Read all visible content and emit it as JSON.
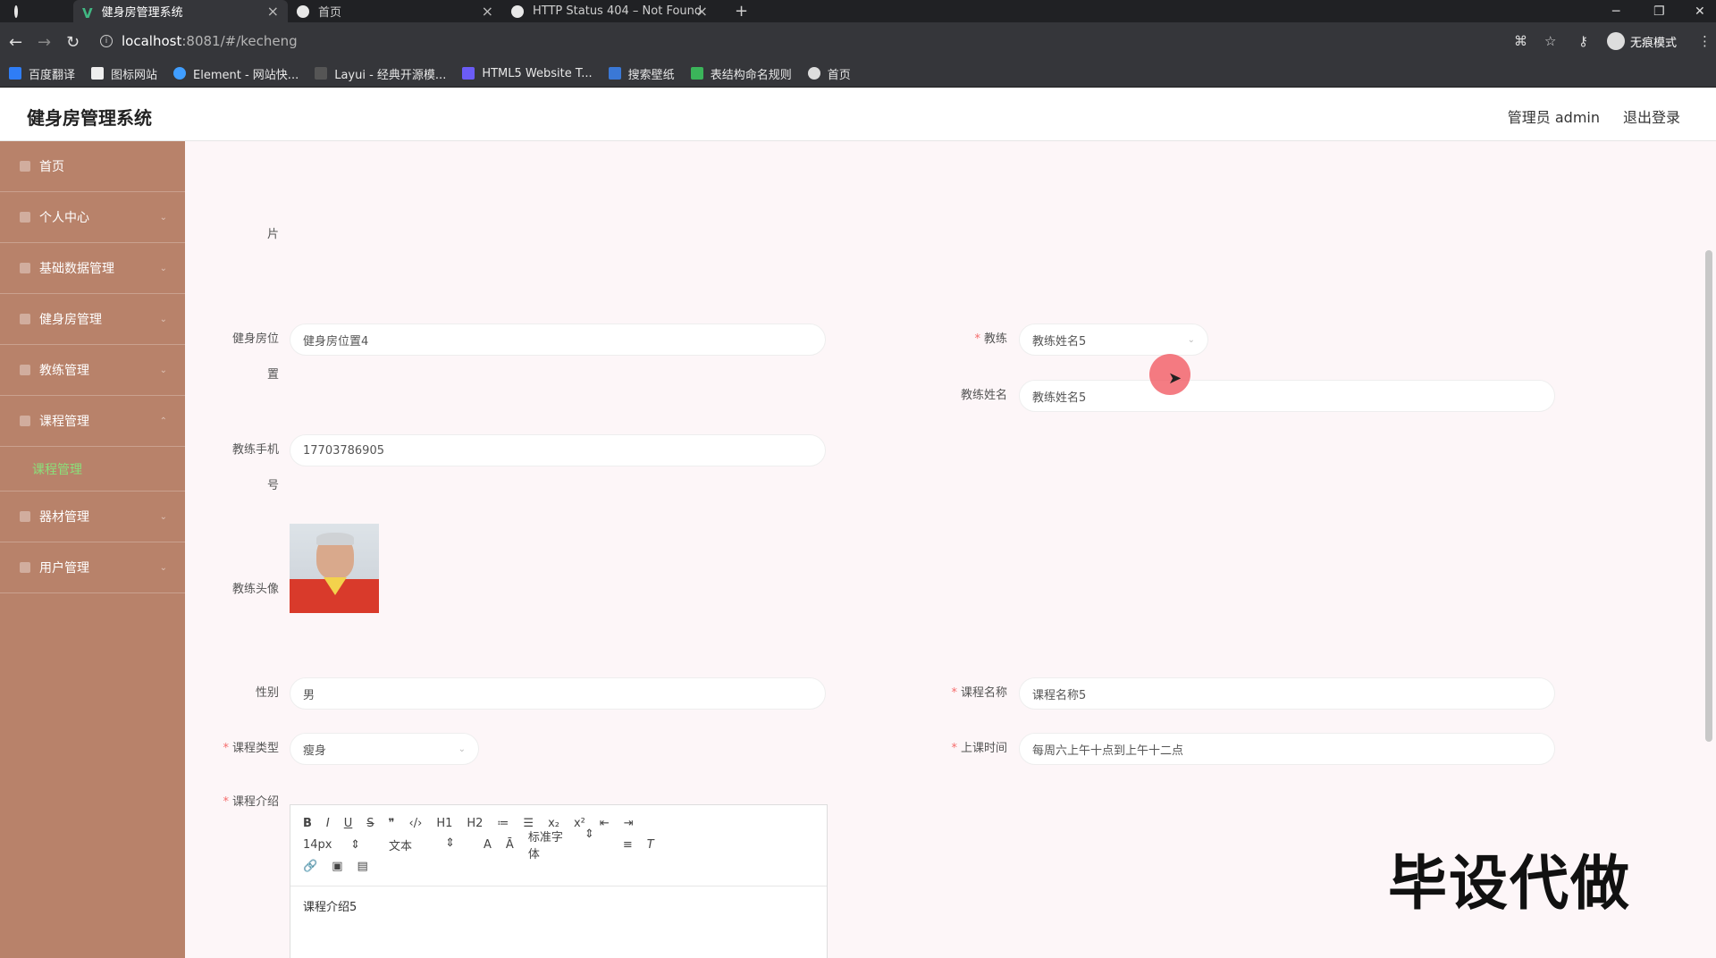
{
  "browser": {
    "tabs": [
      {
        "title": "健身房管理系统",
        "active": true
      },
      {
        "title": "首页",
        "active": false
      },
      {
        "title": "HTTP Status 404 – Not Found",
        "active": false
      }
    ],
    "new_tab": "+",
    "url_host": "localhost",
    "url_path": ":8081/#/kecheng",
    "incognito_label": "无痕模式",
    "bookmarks": [
      "百度翻译",
      "图标网站",
      "Element - 网站快...",
      "Layui - 经典开源模...",
      "HTML5 Website T...",
      "搜索壁纸",
      "表结构命名规则",
      "首页"
    ]
  },
  "header": {
    "title": "健身房管理系统",
    "user": "管理员 admin",
    "logout": "退出登录"
  },
  "sidebar": {
    "items": [
      {
        "label": "首页"
      },
      {
        "label": "个人中心"
      },
      {
        "label": "基础数据管理"
      },
      {
        "label": "健身房管理"
      },
      {
        "label": "教练管理"
      },
      {
        "label": "课程管理"
      }
    ],
    "submenu_active": "课程管理",
    "items_after": [
      {
        "label": "器材管理"
      },
      {
        "label": "用户管理"
      }
    ]
  },
  "form": {
    "top_label_fragment": "片",
    "gym_location_label_1": "健身房位",
    "gym_location_label_2": "置",
    "gym_location_value": "健身房位置4",
    "coach_label": "教练",
    "coach_value": "教练姓名5",
    "coach_name_label": "教练姓名",
    "coach_name_value": "教练姓名5",
    "coach_phone_label_1": "教练手机",
    "coach_phone_label_2": "号",
    "coach_phone_value": "17703786905",
    "coach_avatar_label": "教练头像",
    "gender_label": "性别",
    "gender_value": "男",
    "course_name_label": "课程名称",
    "course_name_value": "课程名称5",
    "course_type_label": "课程类型",
    "course_type_value": "瘦身",
    "class_time_label": "上课时间",
    "class_time_value": "每周六上午十点到上午十二点",
    "course_intro_label": "课程介绍",
    "editor": {
      "row1": [
        "B",
        "I",
        "U",
        "S",
        "❞",
        "‹/›",
        "H1",
        "H2",
        "≔",
        "☰",
        "x₂",
        "x²",
        "⇤",
        "⇥"
      ],
      "font_size": "14px",
      "header_select": "文本",
      "font_family": "标准字体",
      "content": "课程介绍5"
    }
  },
  "watermark": "毕设代做"
}
